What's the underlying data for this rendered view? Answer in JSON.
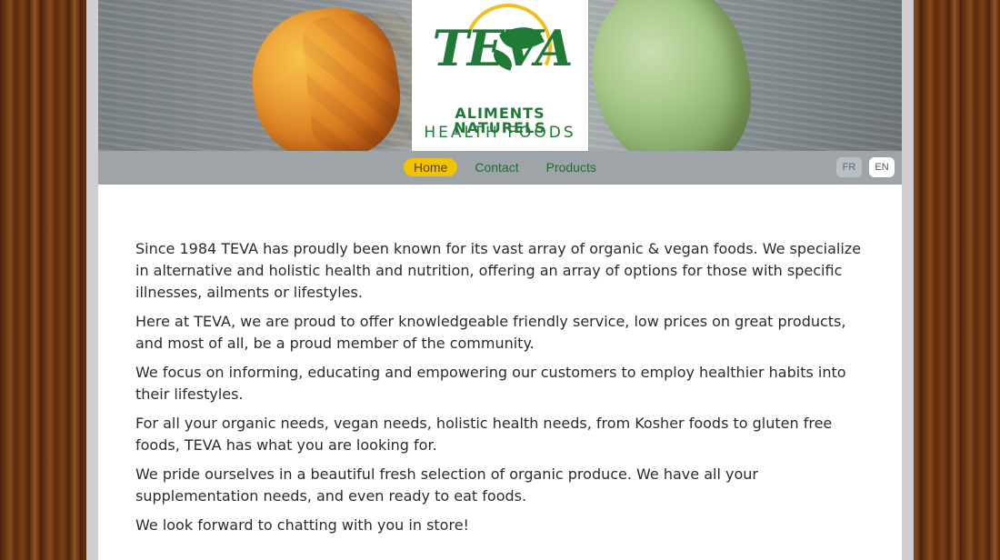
{
  "brand": {
    "word": "TEVA",
    "french": "ALIMENTS NATURELS",
    "english": "HEALTH FOODS"
  },
  "navigation": {
    "items": [
      {
        "label": "Home",
        "state": "active"
      },
      {
        "label": "Contact",
        "state": "inactive"
      },
      {
        "label": "Products",
        "state": "inactive"
      }
    ]
  },
  "language": {
    "fr": "FR",
    "en": "EN"
  },
  "main": {
    "paragraphs": [
      "Since 1984 TEVA has proudly been known for its vast array of organic & vegan foods. We specialize in alternative and holistic health and nutrition, offering an array of options for those with specific illnesses, ailments or lifestyles.",
      "Here at TEVA, we are proud to offer knowledgeable friendly service, low prices on great products, and most of all, be a proud member of the community.",
      "We focus on informing, educating and empowering our customers to employ healthier habits into their lifestyles.",
      "For all your organic needs, vegan needs, holistic health needs, from Kosher foods to gluten free foods, TEVA has what you are looking for.",
      "We pride ourselves in a beautiful fresh selection of organic produce. We have all your supplementation needs, and even ready to eat foods.",
      "We look forward to chatting with you in store!"
    ]
  }
}
